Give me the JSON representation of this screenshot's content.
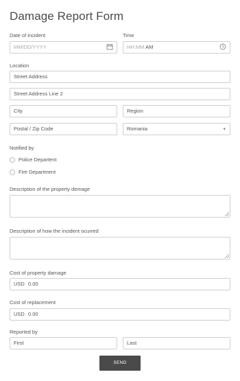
{
  "form": {
    "title": "Damage Report Form",
    "date": {
      "label": "Date of incident",
      "placeholder": "MM/DD/YYYY"
    },
    "time": {
      "label": "Time",
      "placeholder": "HH:MM",
      "ampm": "AM"
    },
    "location": {
      "label": "Location",
      "street1": "Street Address",
      "street2": "Street Address Line 2",
      "city": "City",
      "region": "Region",
      "postal": "Postal / Zip Code",
      "country": "Romania"
    },
    "notified": {
      "label": "Notified by",
      "options": [
        "Police Departent",
        "Fire Department"
      ]
    },
    "description_damage": {
      "label": "Description of the property demage"
    },
    "description_incident": {
      "label": "Description of how the incident ocurred"
    },
    "cost_damage": {
      "label": "Cost of property damage",
      "currency": "USD",
      "value": "0.00"
    },
    "cost_replacement": {
      "label": "Cost of replacement",
      "currency": "USD",
      "value": "0.00"
    },
    "reported_by": {
      "label": "Reported by",
      "first": "First",
      "last": "Last"
    },
    "submit_label": "SEND"
  },
  "icons": {
    "calendar": "calendar-icon",
    "clock": "clock-icon",
    "dropdown": "chevron-down-icon"
  }
}
